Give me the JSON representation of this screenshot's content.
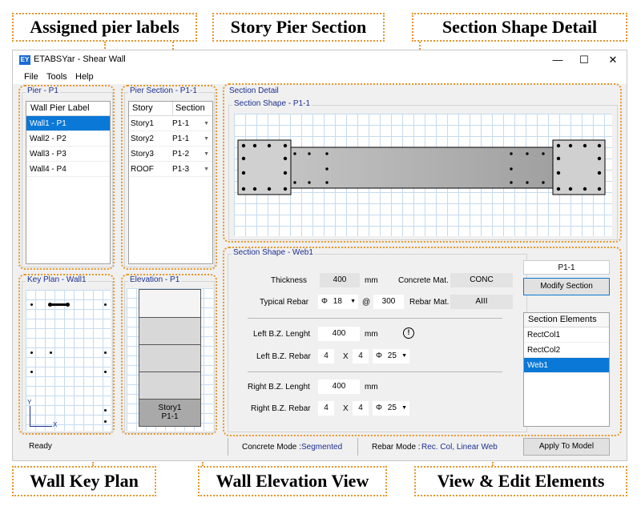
{
  "callouts": {
    "pier_labels": "Assigned pier labels",
    "story_section": "Story Pier Section",
    "section_detail": "Section Shape Detail",
    "key_plan": "Wall Key Plan",
    "elevation_view": "Wall Elevation View",
    "edit_elements": "View & Edit Elements"
  },
  "window": {
    "logo": "EY",
    "title": "ETABSYar - Shear Wall",
    "minimize": "—",
    "maximize": "☐",
    "close": "✕"
  },
  "menu": [
    "File",
    "Tools",
    "Help"
  ],
  "pier_panel": {
    "title": "Pier - P1",
    "header": "Wall Pier Label",
    "items": [
      "Wall1 - P1",
      "Wall2 - P2",
      "Wall3 - P3",
      "Wall4 - P4"
    ],
    "selected": "Wall1 - P1"
  },
  "pier_section_panel": {
    "title": "Pier Section - P1-1",
    "col_story": "Story",
    "col_section": "Section",
    "rows": [
      {
        "story": "Story1",
        "section": "P1-1"
      },
      {
        "story": "Story2",
        "section": "P1-1"
      },
      {
        "story": "Story3",
        "section": "P1-2"
      },
      {
        "story": "ROOF",
        "section": "P1-3"
      }
    ]
  },
  "key_plan_panel": {
    "title": "Key Plan - Wall1",
    "axis_x": "X",
    "axis_y": "Y"
  },
  "elevation_panel": {
    "title": "Elevation - P1",
    "selected_story": "Story1",
    "selected_section": "P1-1"
  },
  "section_detail": {
    "group_title": "Section Detail",
    "shape_title": "Section Shape - P1-1"
  },
  "web_panel": {
    "title": "Section Shape - Web1",
    "thickness_label": "Thickness",
    "thickness_value": "400",
    "thickness_unit": "mm",
    "concrete_label": "Concrete Mat.",
    "concrete_value": "CONC",
    "typical_rebar_label": "Typical Rebar",
    "rebar_phi": "Φ",
    "rebar_dia": "18",
    "rebar_at": "@",
    "rebar_spacing": "300",
    "rebar_mat_label": "Rebar Mat.",
    "rebar_mat_value": "AIII",
    "left_len_label": "Left B.Z. Lenght",
    "left_len_value": "400",
    "left_len_unit": "mm",
    "warning_icon": "!",
    "left_rebar_label": "Left B.Z. Rebar",
    "left_n1": "4",
    "left_x": "X",
    "left_n2": "4",
    "left_phi": "Φ",
    "left_dia": "25",
    "right_len_label": "Right B.Z. Lenght",
    "right_len_value": "400",
    "right_len_unit": "mm",
    "right_rebar_label": "Right B.Z. Rebar",
    "right_n1": "4",
    "right_x": "X",
    "right_n2": "4",
    "right_phi": "Φ",
    "right_dia": "25"
  },
  "section_name": "P1-1",
  "modify_button": "Modify Section",
  "elements_panel": {
    "header": "Section Elements",
    "items": [
      "RectCol1",
      "RectCol2",
      "Web1"
    ],
    "selected": "Web1"
  },
  "status_bar": {
    "ready": "Ready",
    "concrete_mode_label": "Concrete  Mode :",
    "concrete_mode_value": "Segmented",
    "rebar_mode_label": "Rebar Mode :",
    "rebar_mode_value": "Rec. Col, Linear Web",
    "apply_button": "Apply To Model"
  },
  "colors": {
    "accent": "#0a78d7",
    "callout_border": "#e8962b",
    "panel_title": "#1c2f8f"
  }
}
